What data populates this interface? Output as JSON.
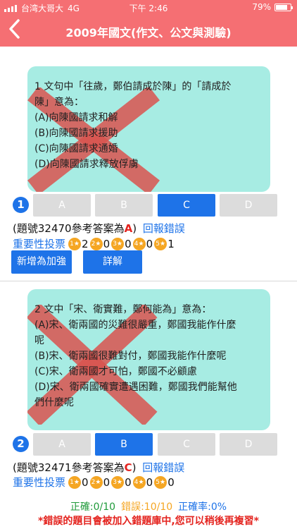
{
  "status_bar": {
    "carrier": "台湾大哥大",
    "network": "4G",
    "time": "下午 2:46",
    "battery": "79%",
    "battery_level": 0.79
  },
  "nav": {
    "back_icon": "chevron-left-icon",
    "title": "2009年國文(作文、公文與測驗)"
  },
  "questions": [
    {
      "number": "1",
      "lines": [
        "1 文句中「往歲，鄭伯請成於陳」的「請成於",
        "陳」意為：",
        "(A)向陳國請求和解",
        "(B)向陳國請求援助",
        "(C)向陳國請求通婚",
        "(D)向陳國請求釋放俘虜"
      ],
      "options": [
        "A",
        "B",
        "C",
        "D"
      ],
      "selected": "C",
      "ref_prefix": "(題號32470參考答案為",
      "ref_answer": "A",
      "ref_suffix": ")",
      "report": "回報錯誤",
      "vote_label": "重要性投票",
      "votes": [
        {
          "star": "1★",
          "count": "2"
        },
        {
          "star": "2★",
          "count": "0"
        },
        {
          "star": "3★",
          "count": "0"
        },
        {
          "star": "4★",
          "count": "0"
        },
        {
          "star": "5★",
          "count": "1"
        }
      ],
      "add_button": "新增為加強",
      "detail_button": "詳解"
    },
    {
      "number": "2",
      "lines": [
        "2 文中「宋、衛實難，鄭何能為」意為：",
        "(A)宋、衛兩國的災難很嚴重，鄭國我能作什麼",
        "呢",
        "(B)宋、衛兩國很難對付，鄭國我能作什麼呢",
        "(C)宋、衛兩國才可怕，鄭國不必顧慮",
        "(D)宋、衛兩國確實遭遇困難，鄭國我們能幫他",
        "們什麼呢"
      ],
      "options": [
        "A",
        "B",
        "C",
        "D"
      ],
      "selected": "B",
      "ref_prefix": "(題號32471參考答案為",
      "ref_answer": "C",
      "ref_suffix": ")",
      "report": "回報錯誤",
      "vote_label": "重要性投票",
      "votes": [
        {
          "star": "1★",
          "count": "0"
        },
        {
          "star": "2★",
          "count": "0"
        },
        {
          "star": "3★",
          "count": "0"
        },
        {
          "star": "4★",
          "count": "0"
        },
        {
          "star": "5★",
          "count": "0"
        }
      ]
    }
  ],
  "footer": {
    "correct": "正確:0/10",
    "wrong": "錯誤:10/10",
    "rate": "正確率:0%",
    "warning": "*錯誤的題目會被加入錯題庫中,您可以稍後再複習*"
  },
  "colors": {
    "header": "#f56f73",
    "card": "#a7ece3",
    "accent": "#1e73e8",
    "wrong_mark": "#d9534f",
    "answer": "#e4231e",
    "star": "#f5a623"
  }
}
